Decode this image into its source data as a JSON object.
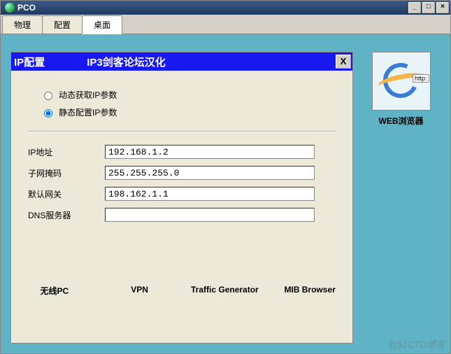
{
  "window": {
    "title": "PCO",
    "controls": {
      "min": "_",
      "max": "□",
      "close": "×"
    }
  },
  "tabs": [
    {
      "label": "物理",
      "active": false
    },
    {
      "label": "配置",
      "active": false
    },
    {
      "label": "桌面",
      "active": true
    }
  ],
  "dialog": {
    "title1": "IP配置",
    "title2": "IP3剑客论坛汉化",
    "close": "X",
    "radio": {
      "dhcp": "动态获取IP参数",
      "static": "静态配置IP参数",
      "selected": "static"
    },
    "fields": {
      "ip": {
        "label": "IP地址",
        "value": "192.168.1.2"
      },
      "mask": {
        "label": "子网掩码",
        "value": "255.255.255.0"
      },
      "gateway": {
        "label": "默认网关",
        "value": "198.162.1.1"
      },
      "dns": {
        "label": "DNS服务器",
        "value": ""
      }
    }
  },
  "desktop": {
    "web_browser": {
      "label": "WEB浏览器",
      "tag": "http:"
    }
  },
  "bottom_icons": [
    "无线PC",
    "VPN",
    "Traffic Generator",
    "MIB Browser"
  ],
  "watermark": "@51CTO博客"
}
